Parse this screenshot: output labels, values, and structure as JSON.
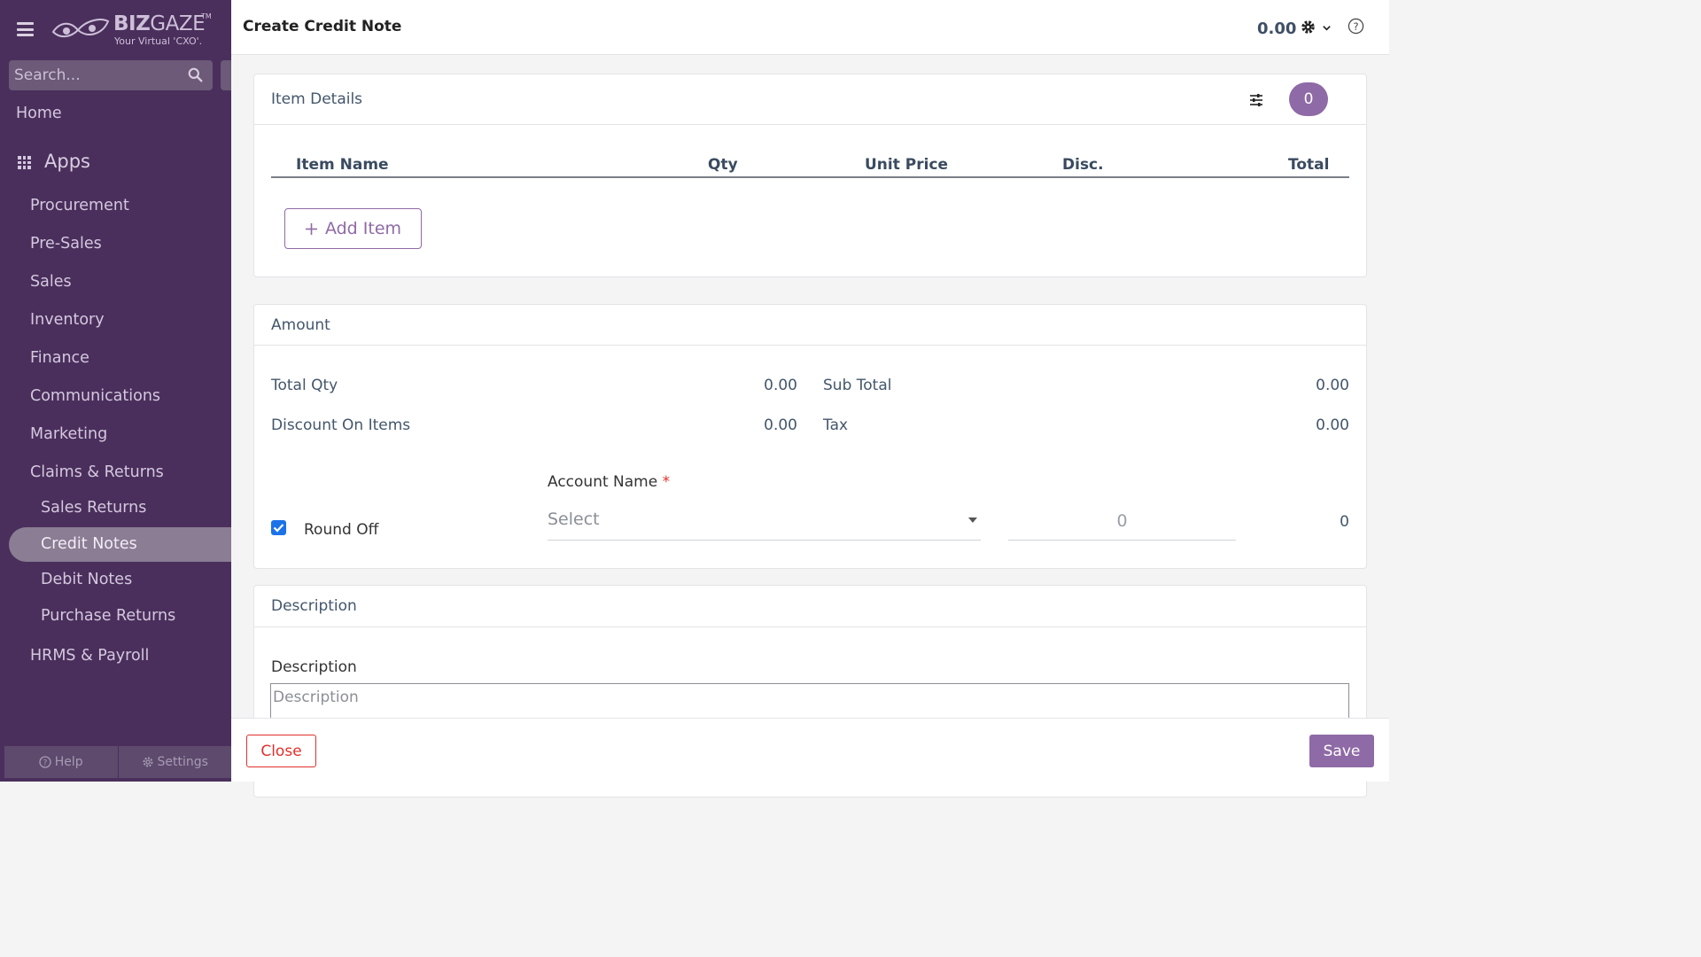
{
  "brand": {
    "name_bold": "BIZ",
    "name_light": "GAZE",
    "trademark": "TM",
    "tagline": "Your Virtual 'CXO'."
  },
  "sidebar": {
    "search_placeholder": "Search...",
    "home": "Home",
    "apps_label": "Apps",
    "items": [
      {
        "label": "Procurement"
      },
      {
        "label": "Pre-Sales"
      },
      {
        "label": "Sales"
      },
      {
        "label": "Inventory"
      },
      {
        "label": "Finance"
      },
      {
        "label": "Communications"
      },
      {
        "label": "Marketing"
      },
      {
        "label": "Claims & Returns"
      },
      {
        "label": "Sales Returns"
      },
      {
        "label": "Credit Notes",
        "active": true
      },
      {
        "label": "Debit Notes"
      },
      {
        "label": "Purchase Returns"
      },
      {
        "label": "HRMS & Payroll"
      }
    ],
    "footer": {
      "help": "Help",
      "settings": "Settings"
    }
  },
  "header": {
    "title": "Create Credit Note",
    "amount": "0.00"
  },
  "item_details": {
    "title": "Item Details",
    "count": "0",
    "columns": [
      "Item Name",
      "Qty",
      "Unit Price",
      "Disc.",
      "Total"
    ],
    "add_item_label": "Add Item"
  },
  "amount": {
    "title": "Amount",
    "total_qty_label": "Total Qty",
    "total_qty_value": "0.00",
    "sub_total_label": "Sub Total",
    "sub_total_value": "0.00",
    "discount_label": "Discount On Items",
    "discount_value": "0.00",
    "tax_label": "Tax",
    "tax_value": "0.00",
    "round_off_label": "Round Off",
    "round_off_checked": true,
    "account_name_label": "Account Name",
    "required_mark": "*",
    "account_placeholder": "Select",
    "round_off_input": "0",
    "round_off_total": "0"
  },
  "description": {
    "title": "Description",
    "field_label": "Description",
    "placeholder": "Description"
  },
  "actions": {
    "close": "Close",
    "save": "Save"
  },
  "colors": {
    "sidebar_bg": "#4a2f5c",
    "accent": "#8e6aa6",
    "danger": "#e0302c",
    "checkbox": "#1a73e8"
  }
}
